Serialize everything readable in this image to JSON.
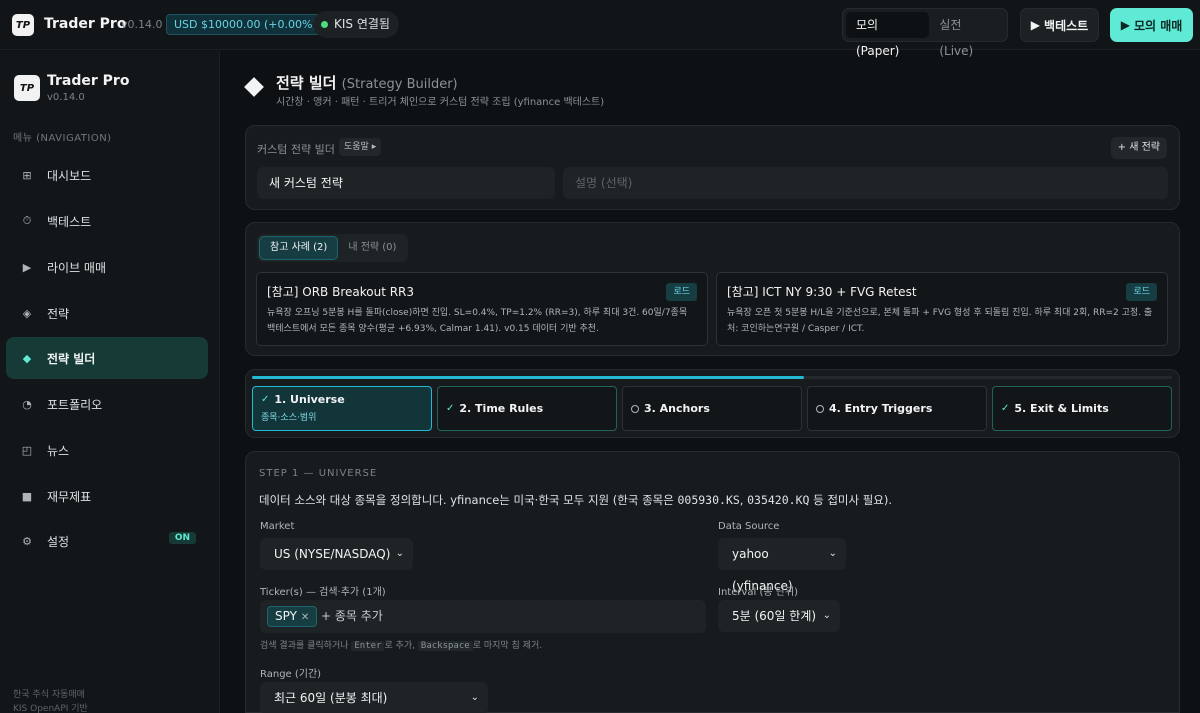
{
  "topbar": {
    "logo_text": "TP",
    "title": "Trader Pro",
    "version": "v0.14.0",
    "balance": "USD $10000.00 (+0.00%)",
    "kis_status": "KIS 연결됨",
    "mode_paper": "모의 (Paper)",
    "mode_live": "실전 (Live)",
    "backtest_btn": "백테스트",
    "paper_trade_btn": "모의 매매"
  },
  "sidebar": {
    "title": "Trader Pro",
    "version": "v0.14.0",
    "section_label": "메뉴 (NAVIGATION)",
    "items": [
      {
        "label": "대시보드",
        "icon": "grid-icon"
      },
      {
        "label": "백테스트",
        "icon": "clock-icon"
      },
      {
        "label": "라이브 매매",
        "icon": "play-icon"
      },
      {
        "label": "전략",
        "icon": "diamond-outline-icon"
      },
      {
        "label": "전략 빌더",
        "icon": "diamond-icon"
      },
      {
        "label": "포트폴리오",
        "icon": "pie-icon"
      },
      {
        "label": "뉴스",
        "icon": "news-icon"
      },
      {
        "label": "재무제표",
        "icon": "square-icon"
      },
      {
        "label": "설정",
        "icon": "gear-icon"
      }
    ],
    "settings_badge": "ON",
    "footer_line1": "한국 주식 자동매매",
    "footer_line2": "KIS OpenAPI 기반"
  },
  "header": {
    "title": "전략 빌더",
    "title_sub": "(Strategy Builder)",
    "description": "시간창 · 앵커 · 패턴 · 트리거 체인으로 커스텀 전략 조립 (yfinance 백테스트)"
  },
  "builder": {
    "label": "커스텀 전략 빌더",
    "help": "도움말 ▸",
    "new_strategy": "+ 새 전략",
    "name_value": "새 커스텀 전략",
    "desc_placeholder": "설명 (선택)"
  },
  "templates": {
    "tab_samples": "참고 사례 (2)",
    "tab_mine": "내 전략 (0)",
    "load_label": "로드",
    "samples": [
      {
        "title": "[참고] ORB Breakout RR3",
        "desc": "뉴욕장 오프닝 5분봉 H를 돌파(close)하면 진입. SL=0.4%, TP=1.2% (RR=3), 하루 최대 3건. 60일/7종목 백테스트에서 모든 종목 양수(평균 +6.93%, Calmar 1.41). v0.15 데이터 기반 추천."
      },
      {
        "title": "[참고] ICT NY 9:30 + FVG Retest",
        "desc": "뉴욕장 오픈 첫 5분봉 H/L을 기준선으로, 본체 돌파 + FVG 형성 후 되돌림 진입. 하루 최대 2회, RR=2 고정. 출처: 코인하는연구원 / Casper / ICT."
      }
    ]
  },
  "steps": {
    "progress": 0.6,
    "items": [
      {
        "label": "1. Universe",
        "sub": "종목·소스·범위",
        "state": "active"
      },
      {
        "label": "2. Time Rules",
        "sub": "",
        "state": "done"
      },
      {
        "label": "3. Anchors",
        "sub": "",
        "state": "todo"
      },
      {
        "label": "4. Entry Triggers",
        "sub": "",
        "state": "todo"
      },
      {
        "label": "5. Exit & Limits",
        "sub": "",
        "state": "done"
      }
    ]
  },
  "universe": {
    "heading": "STEP 1 — UNIVERSE",
    "intro_pre": "데이터 소스와 대상 종목을 정의합니다. yfinance는 미국·한국 모두 지원 (한국 종목은 ",
    "code1": "005930.KS",
    "intro_sep": ", ",
    "code2": "035420.KQ",
    "intro_post": " 등 접미사 필요).",
    "market_label": "Market",
    "market_value": "US (NYSE/NASDAQ)",
    "source_label": "Data Source",
    "source_value": "yahoo (yfinance)",
    "tickers_label": "Ticker(s) — 검색·추가 (1개)",
    "ticker_chip": "SPY",
    "add_ticker": "+ 종목 추가",
    "interval_label": "Interval (봉 단위)",
    "interval_value": "5분 (60일 한계)",
    "hint_pre": "검색 결과를 클릭하거나 ",
    "hint_key1": "Enter",
    "hint_mid": "로 추가, ",
    "hint_key2": "Backspace",
    "hint_post": "로 마지막 칩 제거.",
    "range_label": "Range (기간)",
    "range_value": "최근 60일 (분봉 최대)"
  }
}
